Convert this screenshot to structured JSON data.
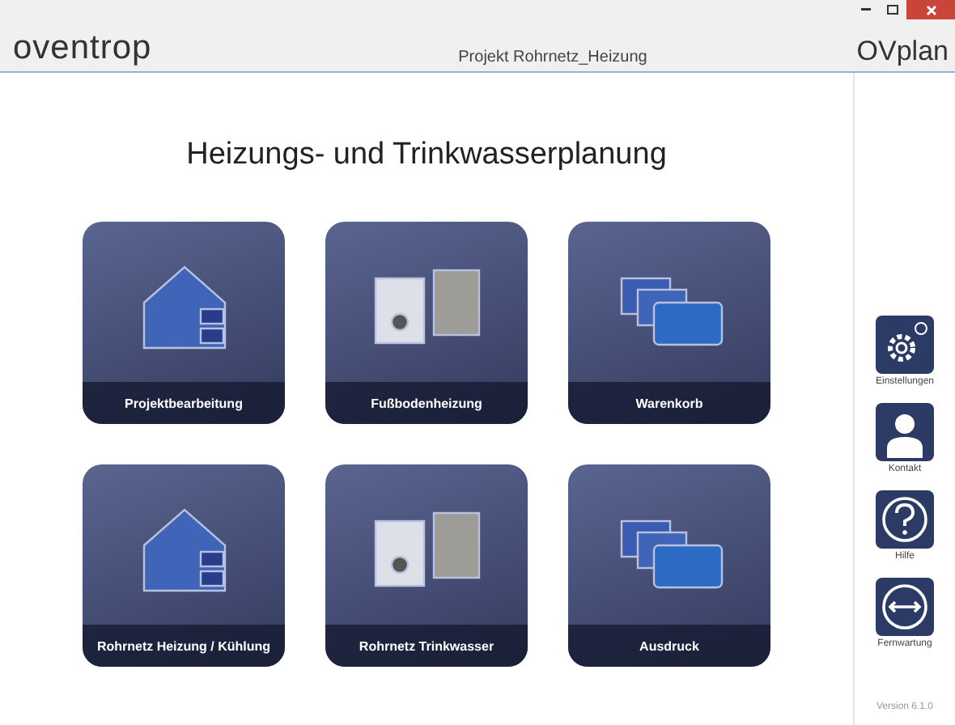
{
  "header": {
    "brand": "oventrop",
    "project": "Projekt Rohrnetz_Heizung",
    "app_name": "OVplan"
  },
  "heading": "Heizungs- und Trinkwasserplanung",
  "tiles": [
    {
      "label": "Projektbearbeitung"
    },
    {
      "label": "Fußbodenheizung"
    },
    {
      "label": "Warenkorb"
    },
    {
      "label": "Rohrnetz Heizung / Kühlung"
    },
    {
      "label": "Rohrnetz Trinkwasser"
    },
    {
      "label": "Ausdruck"
    }
  ],
  "side_buttons": [
    {
      "label": "Einstellungen",
      "kind": "settings"
    },
    {
      "label": "Kontakt",
      "kind": "contact"
    },
    {
      "label": "Hilfe",
      "kind": "help"
    },
    {
      "label": "Fernwartung",
      "kind": "remote"
    }
  ],
  "version": "Version 6.1.0"
}
